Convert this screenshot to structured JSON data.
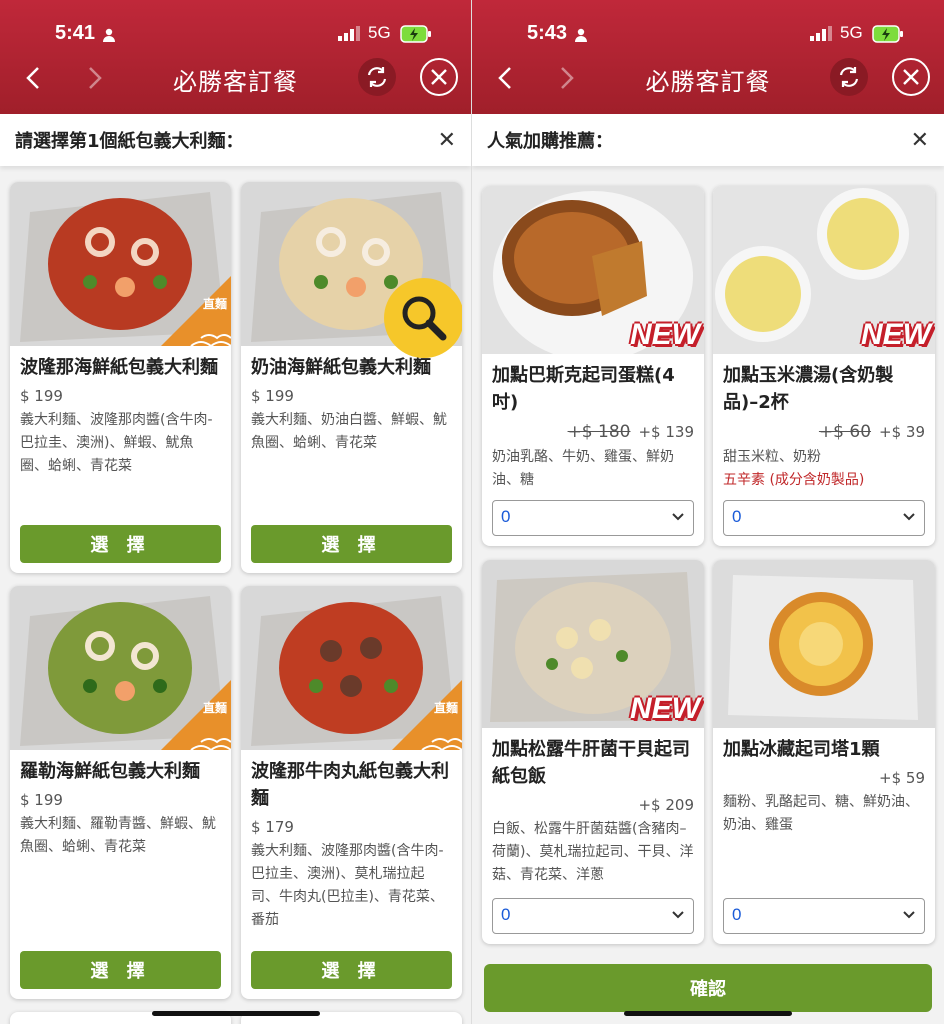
{
  "left": {
    "status": {
      "time": "5:41",
      "network": "5G"
    },
    "nav": {
      "title": "必勝客訂餐"
    },
    "subheader": {
      "title": "請選擇第1個紙包義大利麵："
    },
    "select_label": "選 擇",
    "badge_zhimian": "直麵",
    "items": [
      {
        "name": "波隆那海鮮紙包義大利麵",
        "price": "$ 199",
        "desc": "義大利麵、波隆那肉醬(含牛肉-巴拉圭、澳洲)、鮮蝦、魷魚圈、蛤蜊、青花菜",
        "sauce": "#b83a22"
      },
      {
        "name": "奶油海鮮紙包義大利麵",
        "price": "$ 199",
        "desc": "義大利麵、奶油白醬、鮮蝦、魷魚圈、蛤蜊、青花菜",
        "sauce": "#e6d2a8"
      },
      {
        "name": "羅勒海鮮紙包義大利麵",
        "price": "$ 199",
        "desc": "義大利麵、羅勒青醬、鮮蝦、魷魚圈、蛤蜊、青花菜",
        "sauce": "#7f9a3a"
      },
      {
        "name": "波隆那牛肉丸紙包義大利麵",
        "price": "$ 179",
        "desc": "義大利麵、波隆那肉醬(含牛肉-巴拉圭、澳洲)、莫札瑞拉起司、牛肉丸(巴拉圭)、青花菜、番茄",
        "sauce": "#bf3d22"
      }
    ]
  },
  "right": {
    "status": {
      "time": "5:43",
      "network": "5G"
    },
    "nav": {
      "title": "必勝客訂餐"
    },
    "subheader": {
      "title": "人氣加購推薦："
    },
    "new_badge": "NEW",
    "confirm_label": "確認",
    "items": [
      {
        "name": "加點巴斯克起司蛋糕(4吋)",
        "old_price": "+$ 180",
        "price": "+$ 139",
        "desc": "奶油乳酪、牛奶、雞蛋、鮮奶油、糖",
        "note": "",
        "qty": "0",
        "is_new": true
      },
      {
        "name": "加點玉米濃湯(含奶製品)–2杯",
        "old_price": "+$ 60",
        "price": "+$ 39",
        "desc": "甜玉米粒、奶粉",
        "note": "五辛素 (成分含奶製品)",
        "qty": "0",
        "is_new": true
      },
      {
        "name": "加點松露牛肝菌干貝起司紙包飯",
        "old_price": "",
        "price": "+$ 209",
        "desc": "白飯、松露牛肝菌菇醬(含豬肉–荷蘭)、莫札瑞拉起司、干貝、洋菇、青花菜、洋蔥",
        "note": "",
        "qty": "0",
        "is_new": true
      },
      {
        "name": "加點冰藏起司塔1顆",
        "old_price": "",
        "price": "+$ 59",
        "desc": "麵粉、乳酪起司、糖、鮮奶油、奶油、雞蛋",
        "note": "",
        "qty": "0",
        "is_new": false
      }
    ]
  },
  "colors": {
    "brand_red": "#b3232f",
    "button_green": "#6a9a2c",
    "qty_blue": "#1a5bd8"
  }
}
